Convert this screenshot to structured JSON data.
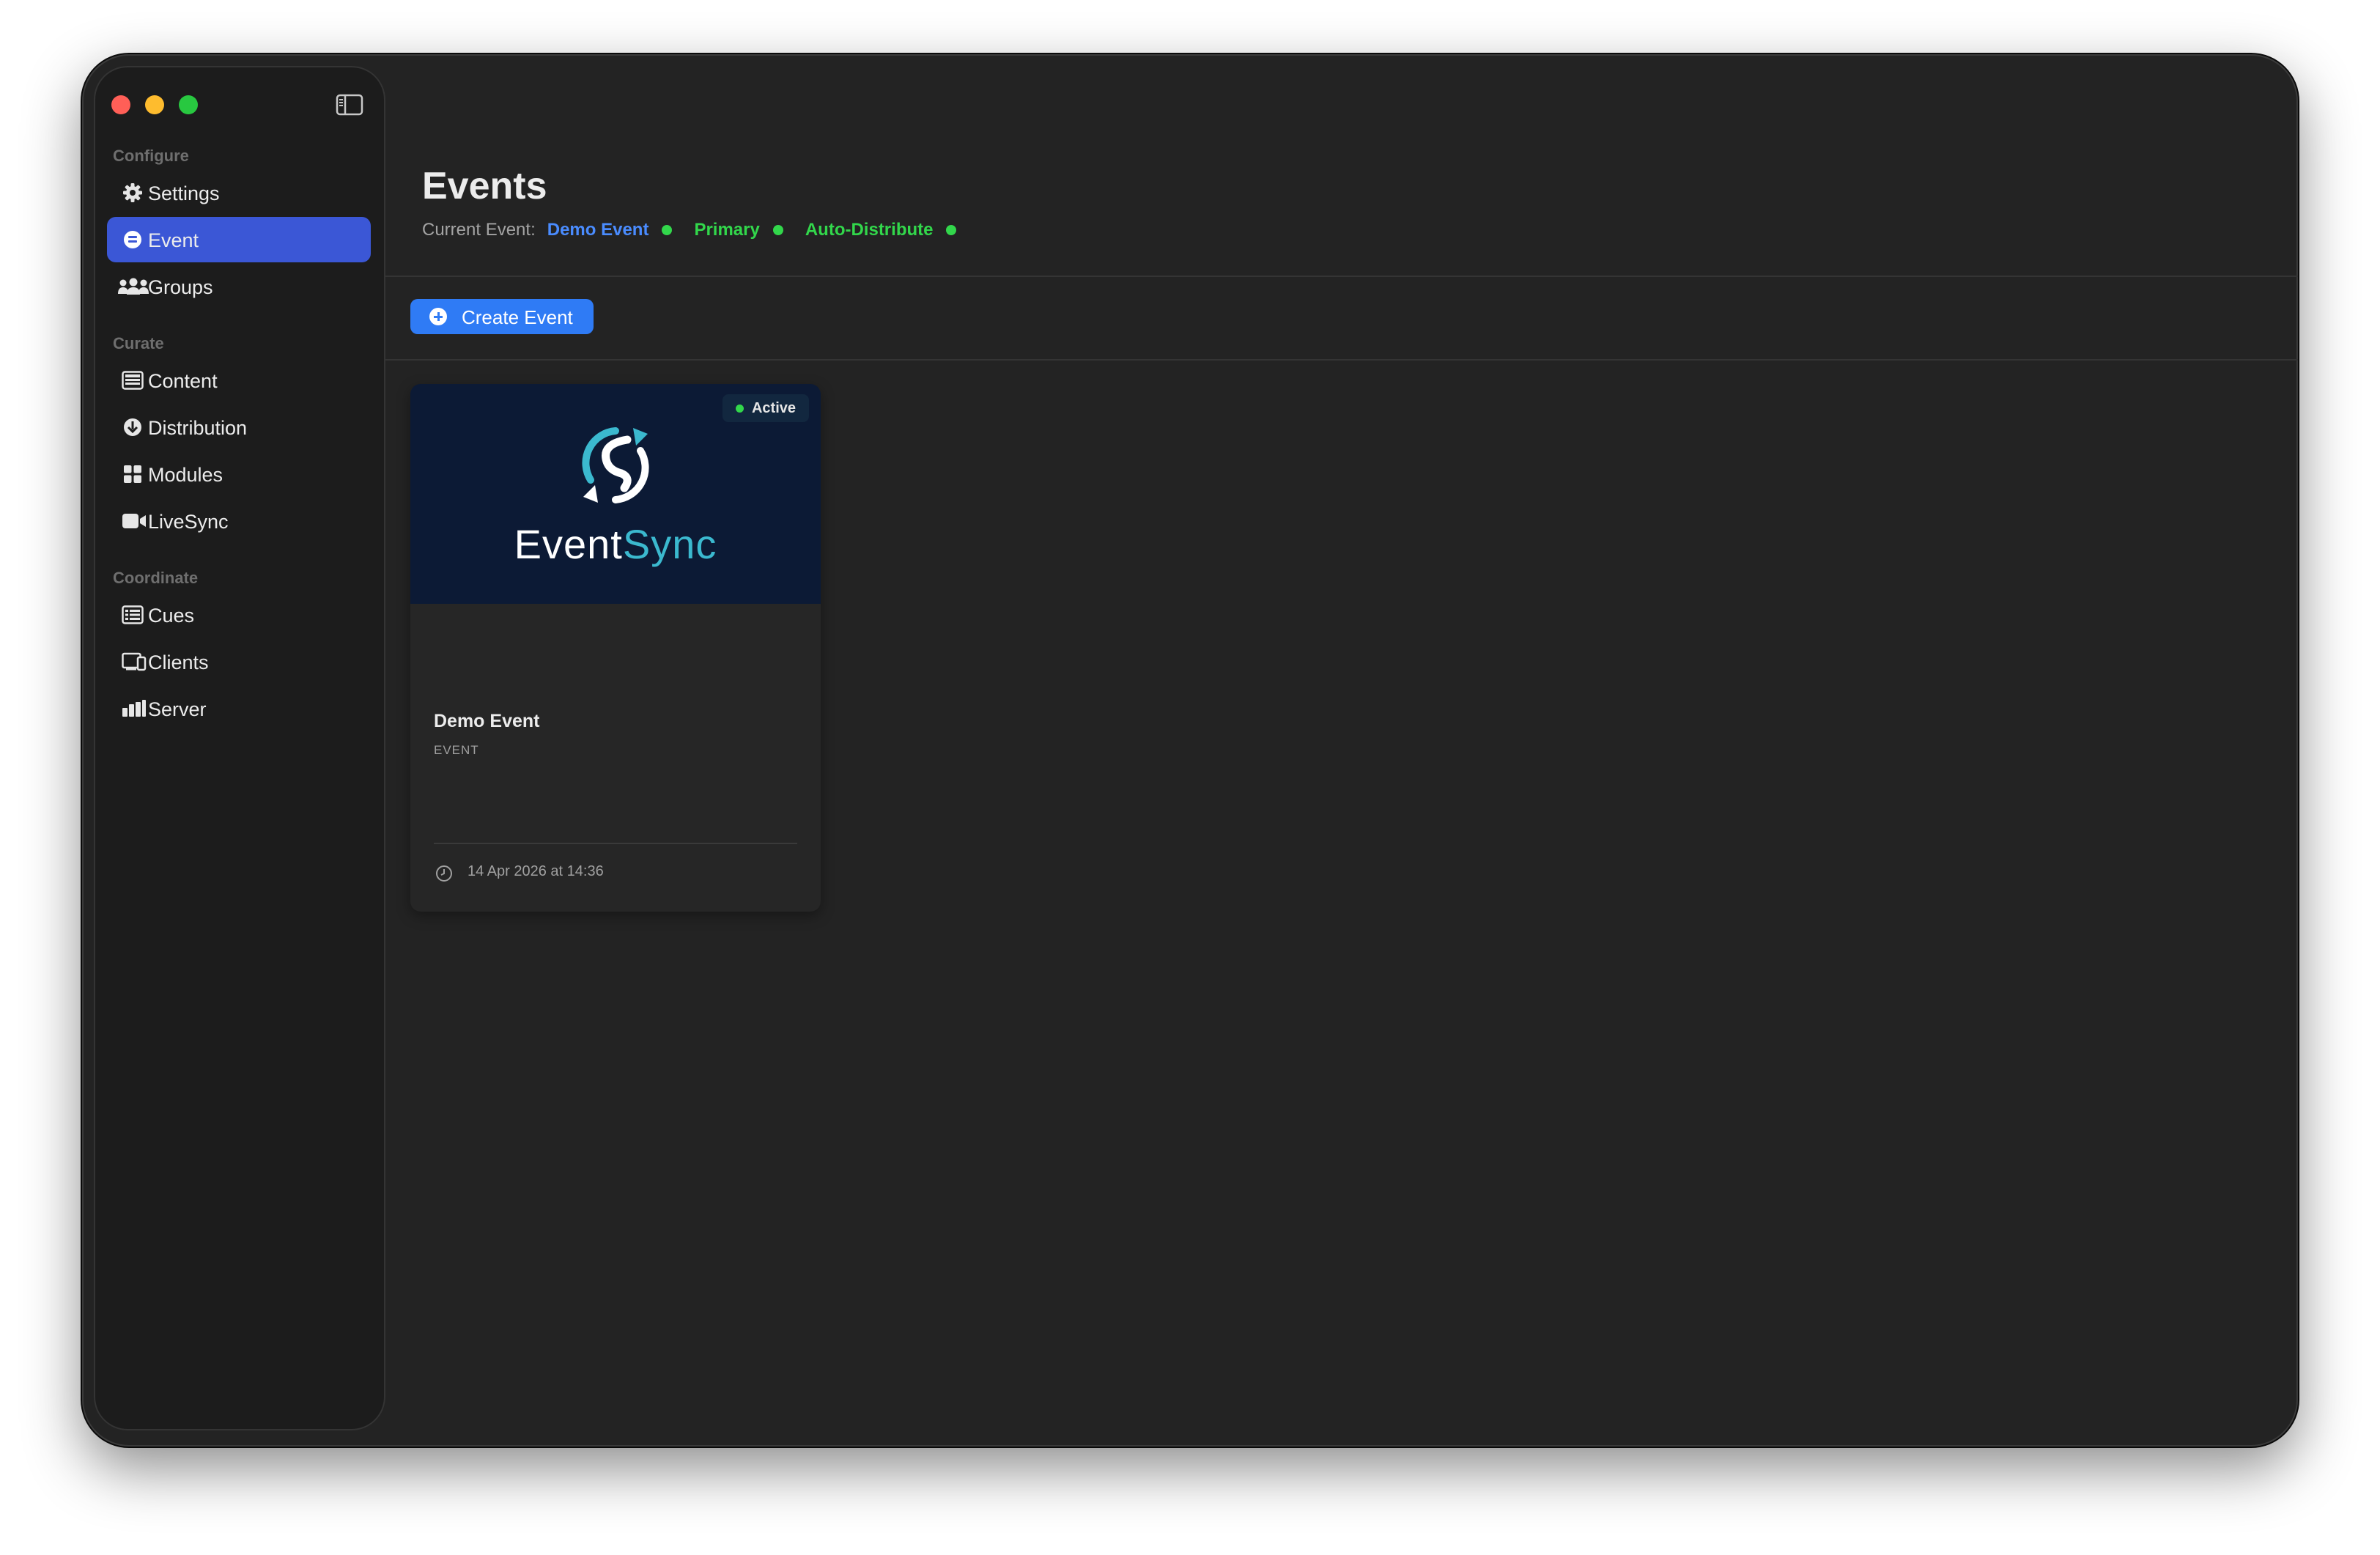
{
  "sidebar": {
    "sections": {
      "configure": "Configure",
      "curate": "Curate",
      "coordinate": "Coordinate"
    },
    "items": {
      "settings": "Settings",
      "event": "Event",
      "groups": "Groups",
      "content": "Content",
      "distribution": "Distribution",
      "modules": "Modules",
      "livesync": "LiveSync",
      "cues": "Cues",
      "clients": "Clients",
      "server": "Server"
    },
    "active_item": "Event"
  },
  "header": {
    "title": "Events",
    "current_event_label": "Current Event:",
    "current_event_value": "Demo Event",
    "primary_label": "Primary",
    "auto_distribute_label": "Auto-Distribute"
  },
  "toolbar": {
    "create_event_label": "Create Event"
  },
  "event_card": {
    "badge": "Active",
    "logo_text_1": "Event",
    "logo_text_2": "Sync",
    "name": "Demo Event",
    "type": "EVENT",
    "date": "14 Apr 2026 at 14:36"
  },
  "colors": {
    "window_bg": "#232323",
    "sidebar_bg": "#1c1c1c",
    "accent_blue": "#3b57d6",
    "button_blue": "#2f7bf5",
    "link_blue": "#4a8cff",
    "status_green": "#32d74b",
    "logo_teal": "#3bb9cf",
    "card_thumb_bg": "#0c1a35"
  },
  "icons": {
    "settings": "gear-icon",
    "event": "event-icon",
    "groups": "people-icon",
    "content": "content-icon",
    "distribution": "download-circle-icon",
    "modules": "grid-icon",
    "livesync": "video-camera-icon",
    "cues": "list-icon",
    "clients": "display-icon",
    "server": "bar-chart-icon",
    "sidebar_toggle": "sidebar-toggle-icon",
    "create": "plus-circle-icon",
    "date": "clock-icon",
    "logo": "sync-arrows-logo-icon"
  }
}
